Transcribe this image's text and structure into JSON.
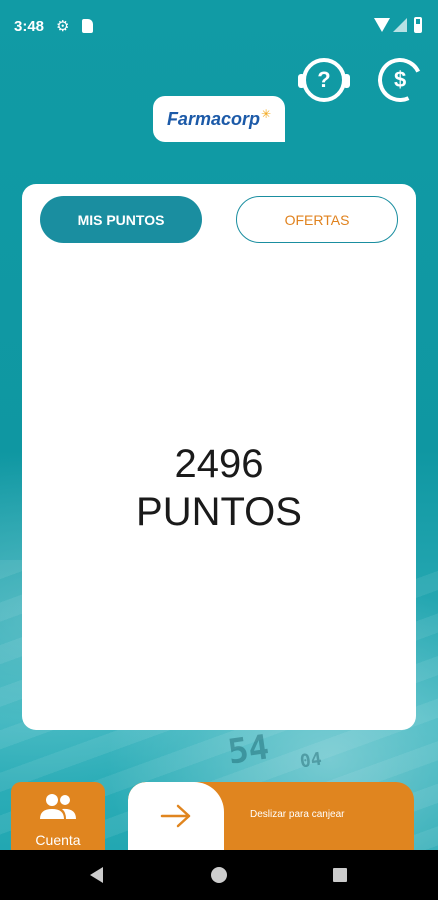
{
  "status_bar": {
    "time": "3:48"
  },
  "header": {
    "logo_text": "Farmacorp",
    "help_icon": "headset-help-icon",
    "refund_icon": "currency-exchange-icon"
  },
  "tabs": [
    {
      "label": "MIS PUNTOS",
      "active": true
    },
    {
      "label": "OFERTAS",
      "active": false
    }
  ],
  "points": {
    "value": "2496",
    "label": "PUNTOS"
  },
  "bottom": {
    "account_label": "Cuenta",
    "slider_text": "Deslizar para canjear"
  },
  "colors": {
    "primary": "#1a8ea0",
    "accent": "#e0851f",
    "background": "#0c9aa6"
  },
  "decor": {
    "card_digits_1": "54",
    "card_digits_2": "04"
  }
}
